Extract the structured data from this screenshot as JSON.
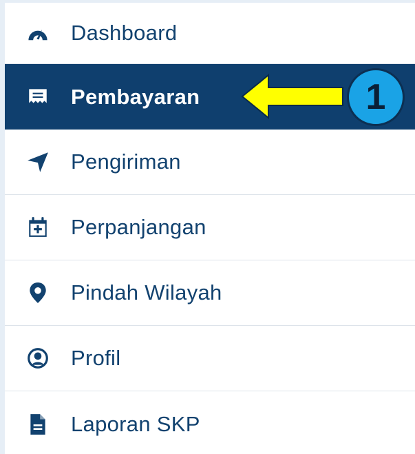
{
  "menu": {
    "items": [
      {
        "label": "Dashboard",
        "icon": "dashboard-gauge-icon"
      },
      {
        "label": "Pembayaran",
        "icon": "receipt-icon",
        "active": true
      },
      {
        "label": "Pengiriman",
        "icon": "paper-plane-icon"
      },
      {
        "label": "Perpanjangan",
        "icon": "calendar-plus-icon"
      },
      {
        "label": "Pindah Wilayah",
        "icon": "location-pin-icon"
      },
      {
        "label": "Profil",
        "icon": "user-circle-icon"
      },
      {
        "label": "Laporan SKP",
        "icon": "document-icon"
      }
    ]
  },
  "annotation": {
    "badge_number": "1",
    "arrow_color": "#ffff00",
    "badge_color": "#1aa3e6"
  },
  "colors": {
    "active_bg": "#0f3f6e",
    "text": "#12426f"
  }
}
